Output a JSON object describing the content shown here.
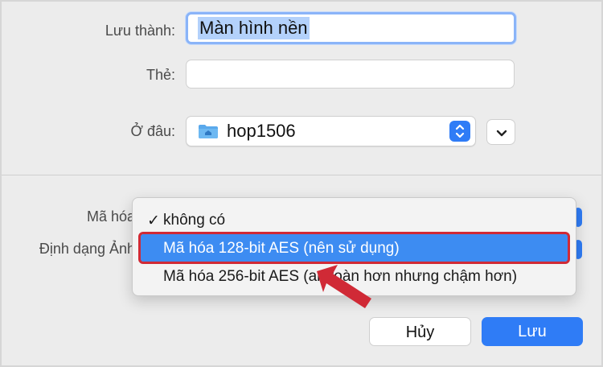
{
  "form": {
    "save_as_label": "Lưu thành:",
    "save_as_value": "Màn hình nền",
    "tags_label": "Thẻ:",
    "tags_value": "",
    "where_label": "Ở đâu:",
    "where_value": "hop1506"
  },
  "options": {
    "encryption_label": "Mã hóa",
    "image_format_label": "Định dạng Ảnh"
  },
  "encryption_menu": {
    "items": [
      {
        "label": "không có",
        "checked": true,
        "highlighted": false
      },
      {
        "label": "Mã hóa 128-bit AES (nên sử dụng)",
        "checked": false,
        "highlighted": true
      },
      {
        "label": "Mã hóa 256-bit AES (an toàn hơn nhưng chậm hơn)",
        "checked": false,
        "highlighted": false
      }
    ],
    "checkmark": "✓"
  },
  "buttons": {
    "cancel_label": "Hủy",
    "save_label": "Lưu"
  },
  "colors": {
    "accent": "#2f7cf6",
    "highlight_outline": "#d02a36",
    "annotation_arrow": "#d02a36"
  },
  "icons": {
    "folder": "folder-icon",
    "stepper": "updown-stepper-icon",
    "chevron": "chevron-down-icon",
    "annotation": "red-arrow-icon"
  }
}
